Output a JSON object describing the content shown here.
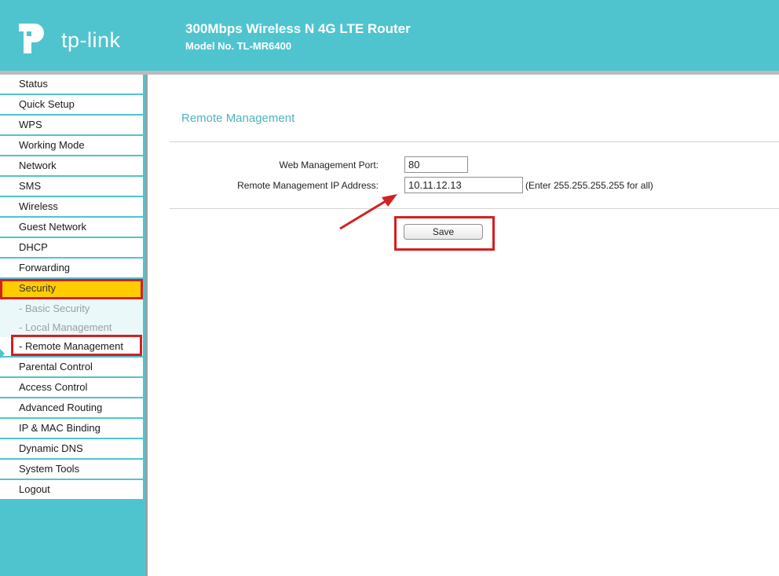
{
  "header": {
    "brand": "tp-link",
    "title": "300Mbps Wireless N 4G LTE Router",
    "model": "Model No. TL-MR6400"
  },
  "colors": {
    "header_bg": "#4fc4cf",
    "active_item_bg": "#ffcc00",
    "highlight_red": "#d42020",
    "page_title": "#4fb3be"
  },
  "sidebar": {
    "items_top": [
      {
        "label": "Status"
      },
      {
        "label": "Quick Setup"
      },
      {
        "label": "WPS"
      },
      {
        "label": "Working Mode"
      },
      {
        "label": "Network"
      },
      {
        "label": "SMS"
      },
      {
        "label": "Wireless"
      },
      {
        "label": "Guest Network"
      },
      {
        "label": "DHCP"
      },
      {
        "label": "Forwarding"
      }
    ],
    "active": {
      "label": "Security"
    },
    "sub_items": [
      {
        "label": "- Basic Security"
      },
      {
        "label": "- Local Management"
      },
      {
        "label": "- Remote Management"
      }
    ],
    "items_bottom": [
      {
        "label": "Parental Control"
      },
      {
        "label": "Access Control"
      },
      {
        "label": "Advanced Routing"
      },
      {
        "label": "IP & MAC Binding"
      },
      {
        "label": "Dynamic DNS"
      },
      {
        "label": "System Tools"
      },
      {
        "label": "Logout"
      }
    ]
  },
  "main": {
    "page_title": "Remote Management",
    "port_label": "Web Management Port:",
    "port_value": "80",
    "ip_label": "Remote Management IP Address:",
    "ip_value": "10.11.12.13",
    "ip_hint": "(Enter 255.255.255.255 for all)",
    "save_label": "Save"
  },
  "icons": {
    "logo": "tp-link-logo-icon",
    "annotation": "red-arrow-icon"
  }
}
